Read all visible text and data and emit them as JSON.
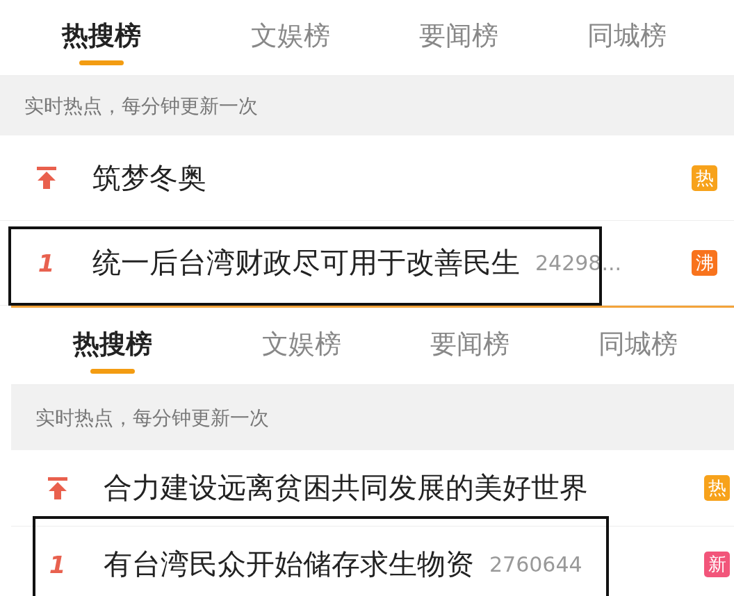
{
  "panels": [
    {
      "tabs": [
        {
          "label": "热搜榜",
          "selected": true
        },
        {
          "label": "文娱榜",
          "selected": false
        },
        {
          "label": "要闻榜",
          "selected": false
        },
        {
          "label": "同城榜",
          "selected": false
        }
      ],
      "notice": "实时热点，每分钟更新一次",
      "rows": [
        {
          "kind": "pinned",
          "title": "筑梦冬奥",
          "badge": {
            "label": "热",
            "color": "#f7a21b"
          },
          "outlined": false
        },
        {
          "kind": "ranked",
          "rank": "1",
          "title": "统一后台湾财政尽可用于改善民生",
          "count": "24298...",
          "badge": {
            "label": "沸",
            "color": "#f8731d"
          },
          "outlined": true
        }
      ]
    },
    {
      "tabs": [
        {
          "label": "热搜榜",
          "selected": true
        },
        {
          "label": "文娱榜",
          "selected": false
        },
        {
          "label": "要闻榜",
          "selected": false
        },
        {
          "label": "同城榜",
          "selected": false
        }
      ],
      "notice": "实时热点，每分钟更新一次",
      "rows": [
        {
          "kind": "pinned",
          "title": "合力建设远离贫困共同发展的美好世界",
          "badge": {
            "label": "热",
            "color": "#f7a21b"
          },
          "outlined": false
        },
        {
          "kind": "ranked",
          "rank": "1",
          "title": "有台湾民众开始储存求生物资",
          "count": "2760644",
          "badge": {
            "label": "新",
            "color": "#f2557a"
          },
          "outlined": true
        }
      ]
    }
  ]
}
